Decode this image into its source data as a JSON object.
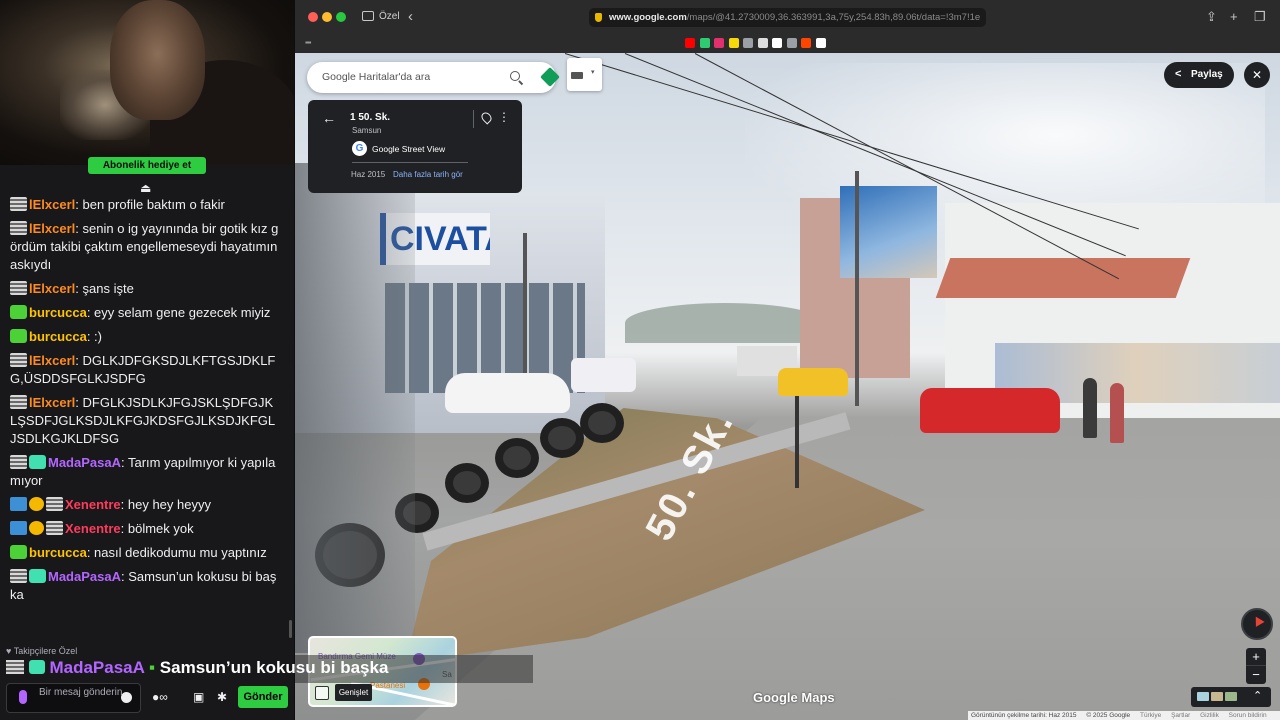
{
  "stream": {
    "subscribe_gift_label": "Abonelik hediye et",
    "scroll_marker": "⏏",
    "followers_only_label": "Takipçilere Özel",
    "chat_placeholder": "Bir mesaj gönderin",
    "send_label": "Gönder",
    "overlay": {
      "user": "MadaPasaA",
      "text": "Samsun’un kokusu bi başka"
    }
  },
  "chat": [
    {
      "user": "lElxcerl",
      "color": "orange",
      "badges": [
        "lines"
      ],
      "text": "ben profile baktım o fakir"
    },
    {
      "user": "lElxcerl",
      "color": "orange",
      "badges": [
        "lines"
      ],
      "text": "senin o ig yayınında bir gotik kız gördüm takibi çaktım engellemeseydi hayatımın askıydı"
    },
    {
      "user": "lElxcerl",
      "color": "orange",
      "badges": [
        "lines"
      ],
      "text": "şans işte"
    },
    {
      "user": "burcucca",
      "color": "yellow",
      "badges": [
        "green"
      ],
      "text": "eyy selam gene gezecek miyiz"
    },
    {
      "user": "burcucca",
      "color": "yellow",
      "badges": [
        "green"
      ],
      "text": ":)"
    },
    {
      "user": "lElxcerl",
      "color": "orange",
      "badges": [
        "lines"
      ],
      "text": "DGLKJDFGKSDJLKFTGSJDKLFG,ÜSDDSFGLKJSDFG"
    },
    {
      "user": "lElxcerl",
      "color": "orange",
      "badges": [
        "lines"
      ],
      "text": "DFGLKJSDLKJFGJSKLŞDFGJKLŞSDFJGLKSDJLKFGJKDSFGJLKSDJKFGLJSDLKGJKLDFSG"
    },
    {
      "user": "MadaPasaA",
      "color": "purple",
      "badges": [
        "lines",
        "teal"
      ],
      "text": "Tarım yapılmıyor ki yapılamıyor"
    },
    {
      "user": "Xenentre",
      "color": "red",
      "badges": [
        "blue",
        "coin",
        "lines"
      ],
      "text": "hey hey heyyy"
    },
    {
      "user": "Xenentre",
      "color": "red",
      "badges": [
        "blue",
        "coin",
        "lines"
      ],
      "text": "bölmek yok"
    },
    {
      "user": "burcucca",
      "color": "yellow",
      "badges": [
        "green"
      ],
      "text": "nasıl dedikodumu mu yaptınız"
    },
    {
      "user": "MadaPasaA",
      "color": "purple",
      "badges": [
        "lines",
        "teal"
      ],
      "text": "Samsun’un kokusu bi başka"
    }
  ],
  "browser": {
    "profile_label": "Özel",
    "url_main": "www.google.com",
    "url_rest": "/maps/@41.2730009,36.363991,3a,75y,254.83h,89.06t/data=!3m7!1e",
    "favicons": [
      "#ff0000",
      "#2ecc71",
      "#e1306c",
      "#f5d90a",
      "#9aa0a6",
      "#dddddd",
      "#ffffff",
      "#9aa0a6",
      "#ff4500",
      "#ffffff"
    ]
  },
  "maps": {
    "search_placeholder": "Google Haritalar'da ara",
    "place_title": "1 50. Sk.",
    "place_subtitle": "Samsun",
    "street_view_label": "Google Street View",
    "capture_date": "Haz 2015",
    "more_dates_label": "Daha fazla tarih gör",
    "share_label": "Paylaş",
    "expand_tooltip": "Genişlet",
    "minimap": {
      "poi1": "Bandırma Gemi Müze",
      "poi2": "Pastanesi",
      "edge": "Sa"
    },
    "logo": "Google Maps",
    "road_marking": "50. Sk.",
    "shop_sign": "CIVATA",
    "attribution": {
      "capture": "Görüntünün çekilme tarihi: Haz 2015",
      "copyright": "© 2025 Google",
      "country": "Türkiye",
      "terms": "Şartlar",
      "privacy": "Gizlilik",
      "report": "Sorun bildirin"
    }
  }
}
